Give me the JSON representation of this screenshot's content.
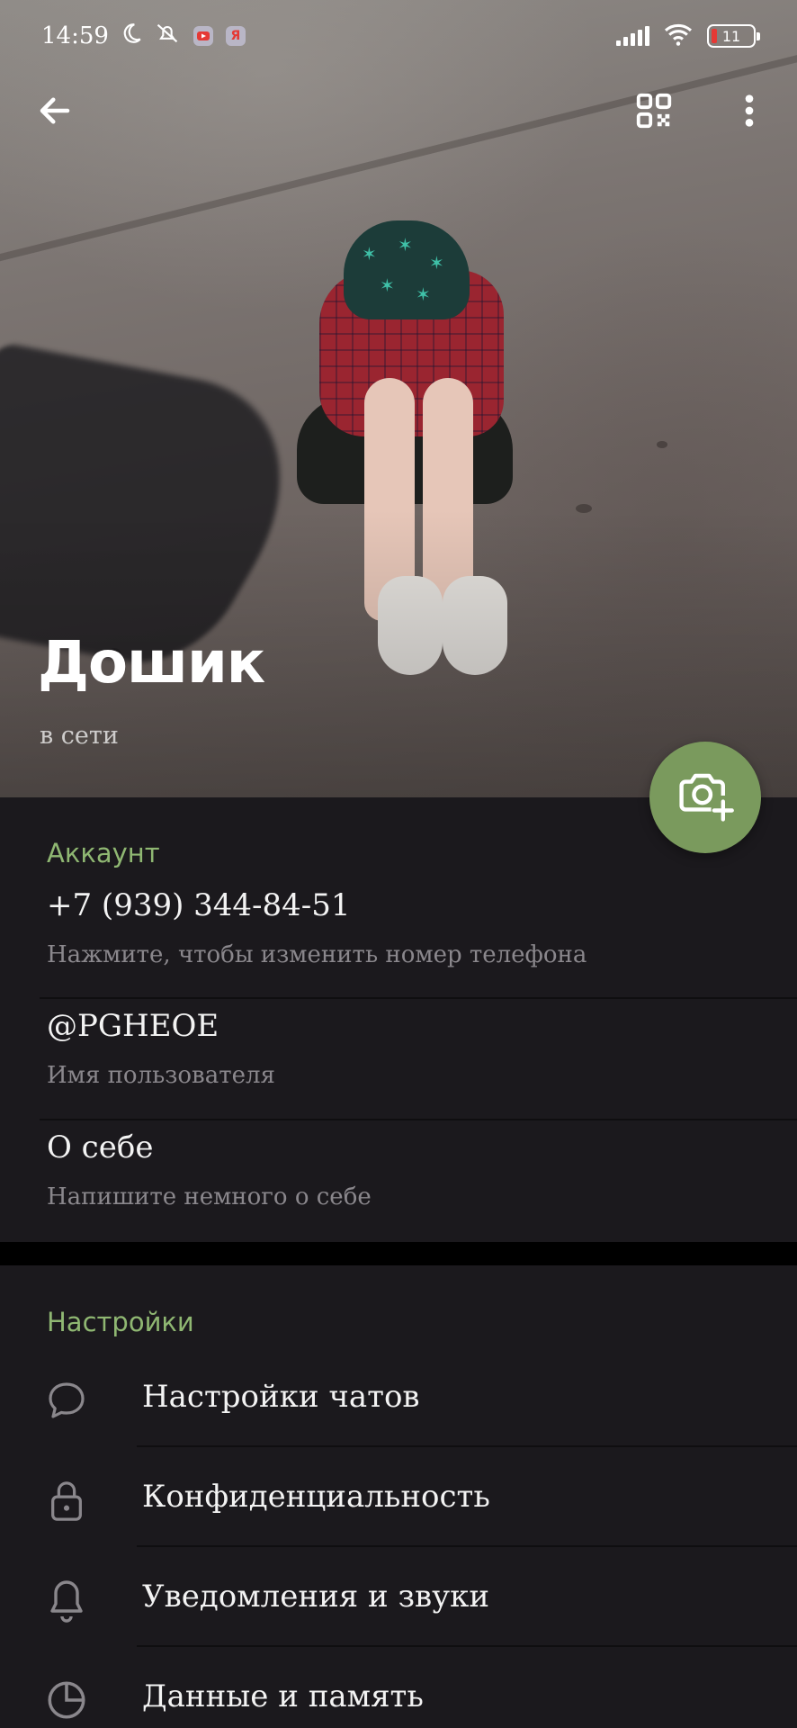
{
  "status_bar": {
    "time": "14:59",
    "battery": "11",
    "icons": [
      "moon-icon",
      "mute-icon",
      "youtube-icon",
      "yandex-icon",
      "signal-icon",
      "wifi-icon",
      "battery-icon"
    ]
  },
  "app_bar": {
    "back_icon": "arrow-left-icon",
    "qr_icon": "qr-code-icon",
    "more_icon": "more-vertical-icon"
  },
  "profile": {
    "name": "Дошик",
    "status": "в сети",
    "fab_icon": "camera-add-icon"
  },
  "account": {
    "title": "Аккаунт",
    "rows": [
      {
        "value": "+7 (939) 344-84-51",
        "hint": "Нажмите, чтобы изменить номер телефона"
      },
      {
        "value": "@PGHEOE",
        "hint": "Имя пользователя"
      },
      {
        "value": "О себе",
        "hint": "Напишите немного о себе"
      }
    ]
  },
  "settings": {
    "title": "Настройки",
    "items": [
      {
        "label": "Настройки чатов",
        "icon": "chat-bubble-icon"
      },
      {
        "label": "Конфиденциальность",
        "icon": "lock-icon"
      },
      {
        "label": "Уведомления и звуки",
        "icon": "bell-icon"
      },
      {
        "label": "Данные и память",
        "icon": "pie-chart-icon"
      }
    ]
  },
  "colors": {
    "accent": "#8fb772",
    "fab": "#7a9a5d",
    "background": "#1b191d",
    "secondary_text": "#8a878c"
  }
}
